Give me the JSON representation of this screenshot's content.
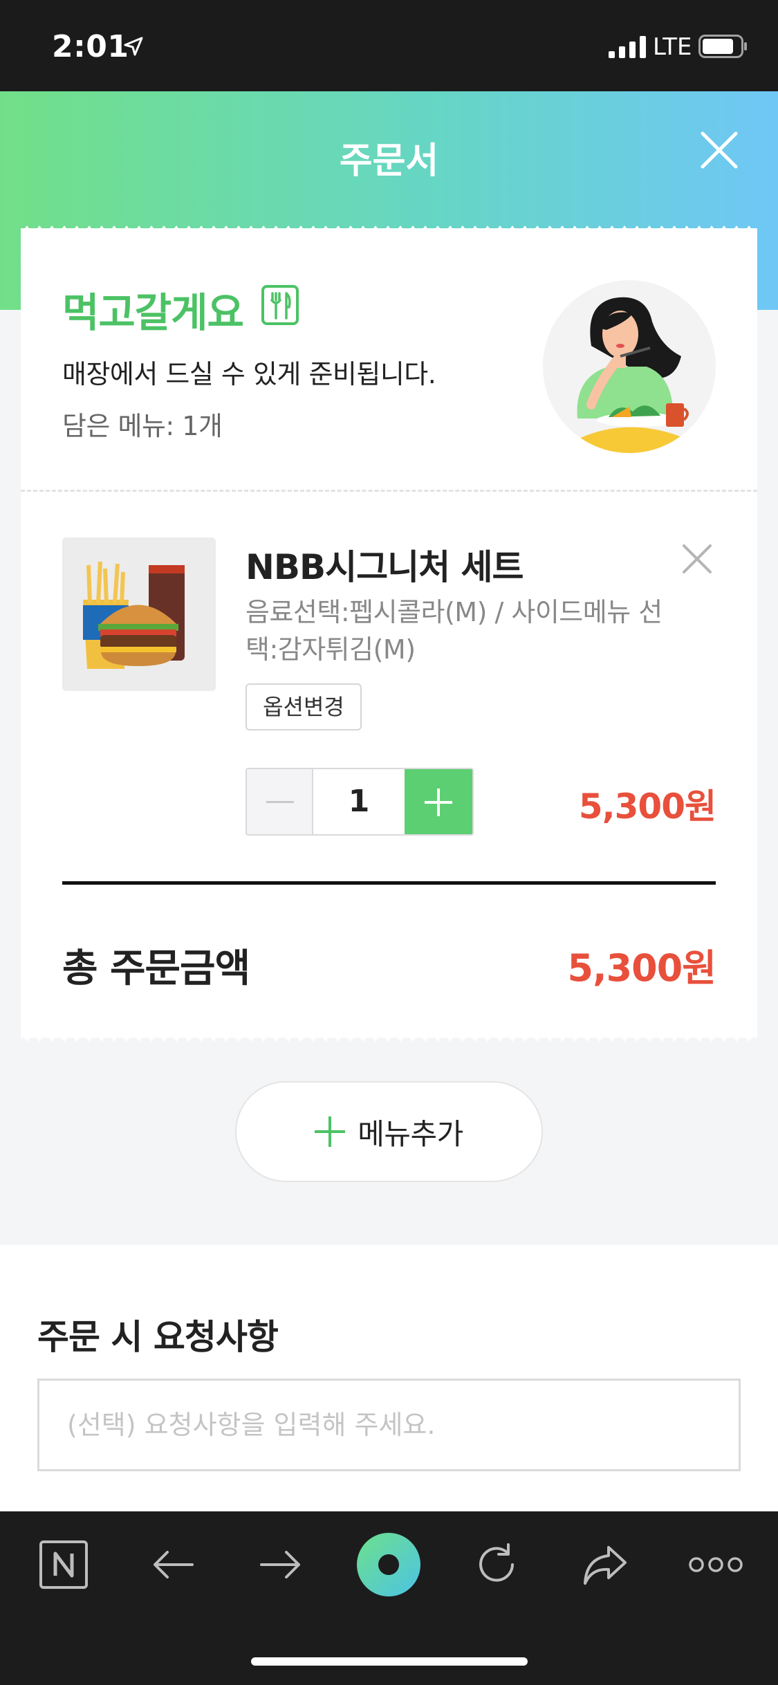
{
  "status_bar": {
    "time": "2:01",
    "network": "LTE"
  },
  "header": {
    "title": "주문서"
  },
  "order_type": {
    "title": "먹고갈게요",
    "description": "매장에서 드실 수 있게 준비됩니다.",
    "count_text": "담은 메뉴: 1개"
  },
  "cart_item": {
    "name": "NBB시그니처 세트",
    "options": "음료선택:펩시콜라(M) / 사이드메뉴 선택:감자튀김(M)",
    "option_change_label": "옵션변경",
    "quantity": "1",
    "price": "5,300원"
  },
  "total": {
    "label": "총 주문금액",
    "price": "5,300원"
  },
  "add_menu": {
    "label": "메뉴추가"
  },
  "request": {
    "title": "주문 시 요청사항",
    "placeholder": "(선택) 요청사항을 입력해 주세요.",
    "value": ""
  },
  "colors": {
    "accent_green": "#4cc265",
    "price_red": "#e8503c",
    "header_gradient_start": "#72df88",
    "header_gradient_end": "#6fc7f6"
  },
  "browser_toolbar": {
    "icons": [
      "naver-icon",
      "back-arrow-icon",
      "forward-arrow-icon",
      "home-circle-icon",
      "refresh-icon",
      "share-icon",
      "more-icon"
    ]
  }
}
